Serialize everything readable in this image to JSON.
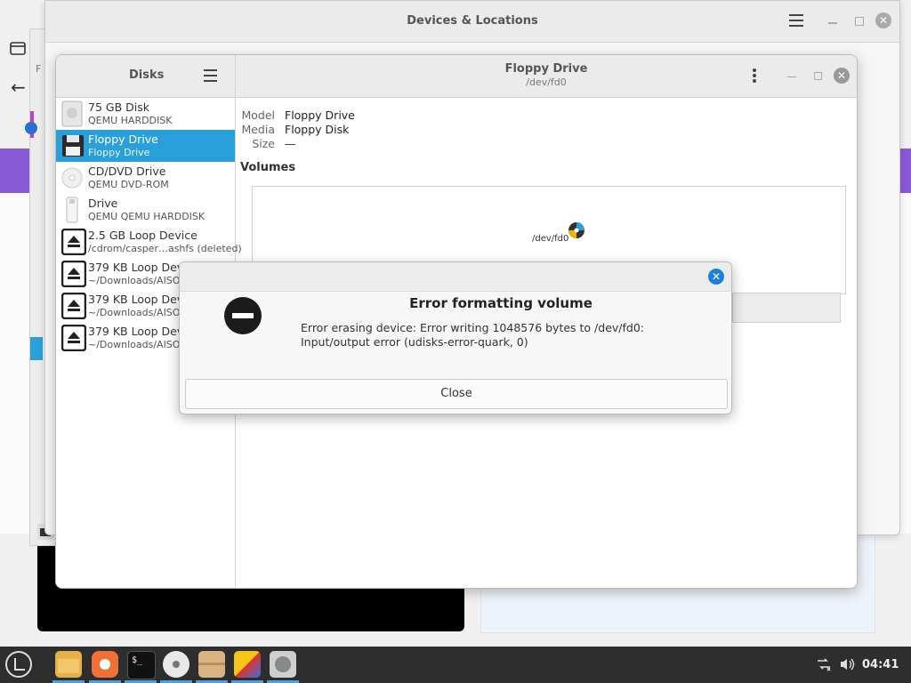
{
  "background": {
    "files_window_letter": "F"
  },
  "devices_window": {
    "title": "Devices & Locations"
  },
  "disks_window": {
    "sidebar_title": "Disks",
    "drive_title": "Floppy Drive",
    "drive_path": "/dev/fd0",
    "drives": [
      {
        "name": "75 GB Disk",
        "sub": "QEMU HARDDISK",
        "icon": "harddisk-icon"
      },
      {
        "name": "Floppy Drive",
        "sub": "Floppy Drive",
        "icon": "floppy-icon",
        "selected": true
      },
      {
        "name": "CD/DVD Drive",
        "sub": "QEMU DVD-ROM",
        "icon": "optical-disc-icon"
      },
      {
        "name": "Drive",
        "sub": "QEMU QEMU HARDDISK",
        "icon": "usb-drive-icon"
      },
      {
        "name": "2.5 GB Loop Device",
        "sub": "/cdrom/casper…ashfs (deleted)",
        "icon": "eject-icon"
      },
      {
        "name": "379 KB Loop Dev",
        "sub": "~/Downloads/AISO.is",
        "icon": "eject-icon"
      },
      {
        "name": "379 KB Loop Dev",
        "sub": "~/Downloads/AISO.is",
        "icon": "eject-icon"
      },
      {
        "name": "379 KB Loop Dev",
        "sub": "~/Downloads/AISO.is",
        "icon": "eject-icon"
      }
    ],
    "info": {
      "model_label": "Model",
      "model_value": "Floppy Drive",
      "media_label": "Media",
      "media_value": "Floppy Disk",
      "size_label": "Size",
      "size_value": "—"
    },
    "volumes_label": "Volumes",
    "volume_device": "/dev/fd0"
  },
  "error_dialog": {
    "title": "Error formatting volume",
    "message": "Error erasing device: Error writing 1048576 bytes to /dev/fd0: Input/output error (udisks-error-quark, 0)",
    "close_label": "Close"
  },
  "taskbar": {
    "clock": "04:41"
  }
}
